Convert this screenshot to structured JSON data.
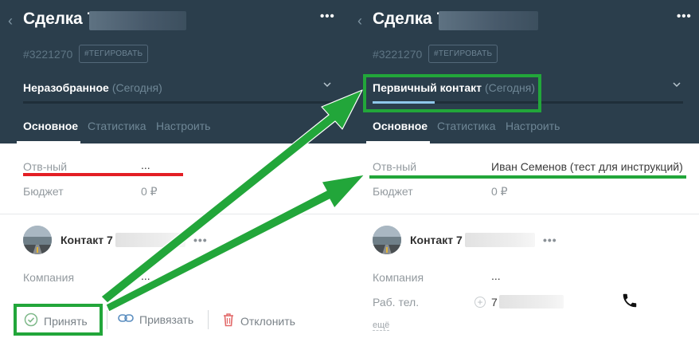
{
  "deal_title": "Сделка 7",
  "lead_id": "#3221270",
  "tag_button": "#ТЕГИРОВАТЬ",
  "more_glyph": "•••",
  "back_glyph": "‹",
  "left": {
    "stage": "Неразобранное",
    "stage_date": "(Сегодня)",
    "tabs": [
      "Основное",
      "Статистика",
      "Настроить"
    ],
    "fields": {
      "responsible_label": "Отв-ный",
      "responsible_value": "...",
      "budget_label": "Бюджет",
      "budget_value": "0 ₽"
    },
    "contact_name": "Контакт 7",
    "company_label": "Компания",
    "company_value": "...",
    "actions": {
      "accept": "Принять",
      "link": "Привязать",
      "decline": "Отклонить"
    }
  },
  "right": {
    "stage": "Первичный контакт",
    "stage_date": "(Сегодня)",
    "stage_progress": 0.2,
    "tabs": [
      "Основное",
      "Статистика",
      "Настроить"
    ],
    "fields": {
      "responsible_label": "Отв-ный",
      "responsible_value": "Иван Семенов (тест для инструкций)",
      "budget_label": "Бюджет",
      "budget_value": "0 ₽"
    },
    "contact_name": "Контакт 7",
    "company_label": "Компания",
    "company_value": "...",
    "phone_label": "Раб. тел.",
    "phone_value": "7",
    "more_link": "ещё"
  },
  "colors": {
    "header_bg": "#2b3e4c",
    "highlight_green": "#22a63a",
    "underline_red": "#e31e24",
    "stage_progress": "#8fc7ea"
  },
  "icons": [
    "chevron-left-icon",
    "more-dots-icon",
    "chevron-down-icon",
    "check-circle-icon",
    "link-icon",
    "trash-icon",
    "phone-icon",
    "plus-circle-icon"
  ]
}
